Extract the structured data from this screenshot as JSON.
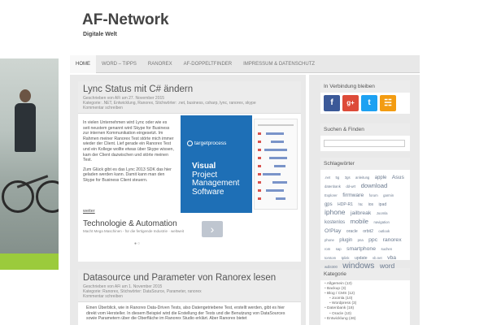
{
  "site": {
    "title": "AF-Network",
    "tagline": "Digitale Welt"
  },
  "nav": [
    {
      "label": "Home",
      "active": true
    },
    {
      "label": "Word – Tipps"
    },
    {
      "label": "Ranorex"
    },
    {
      "label": "AF-Doppeltfinder"
    },
    {
      "label": "Impressum & Datenschutz"
    }
  ],
  "posts": [
    {
      "title": "Lync Status mit C# ändern",
      "meta_line1": "Geschrieben von AFi am 27. November 2015",
      "meta_line2": "Kategorie: .NET, Entwicklung, Ranorex, Stichwörter: .net, business, csharp, lync, ranorex, skype",
      "meta_line3": "Kommentar schreiben",
      "para1": "In vielen Unternehmen wird Lync oder wie es seit neustem genannt wird Skype for Business zur internen Kommunikation eingesetzt. Im Rahmen meiner Ranorex Test störte mich immer wieder der Client. Lief gerade ein Ranorex Test und ein Kollege wollte etwas über Skype wissen, kam der Client dazwischen und störte meinen Test.",
      "para2": "Zum Glück gibt es das Lync 2013 SDK das hier geladen werden kann. Damit kann man den Skype for Business Client steuern.",
      "more": "weiter"
    },
    {
      "title": "Datasource und Parameter von Ranorex lesen",
      "meta_line1": "Geschrieben von AFi am 1. November 2015",
      "meta_line2": "Kategorie: Ranorex, Stichwörter: DataSource, Parameter, ranorex",
      "meta_line3": "Kommentar schreiben",
      "para1": "Einen Überblick, wie in Ranorex Data-Driven Tests, also Datengetriebene Test, erstellt werden, gibt es hier direkt vom Hersteller. In diesem Beispiel wird die Erstellung der Tests und die Benutzung von DataSources sowie Parametern über die Oberfläche im Ranorex Studio erklärt. Aber Ranorex bietet"
    }
  ],
  "ad_banner": {
    "brand": "targetprocess",
    "heading_line1": "Visual",
    "heading_line2": "Project",
    "heading_line3": "Management",
    "heading_line4": "Software",
    "color": "#1e6fb6"
  },
  "ad_text": {
    "title": "Technologie & Automation",
    "subtitle": "Macht Mega Maschinen - für die fertigende Industrie · weltweit",
    "button_icon": "chevron-right-icon"
  },
  "sidebar": {
    "social_title": "In Verbindung bleiben",
    "social": [
      {
        "icon": "f",
        "name": "facebook-icon",
        "color": "#3b5998"
      },
      {
        "icon": "g+",
        "name": "google-plus-icon",
        "color": "#dd4b39"
      },
      {
        "icon": "t",
        "name": "twitter-icon",
        "color": "#1da1f2"
      },
      {
        "icon": "rss",
        "name": "rss-icon",
        "color": "#f39c12"
      }
    ],
    "search_title": "Suchen & Finden",
    "search_placeholder": "",
    "tags_title": "Schlagwörter",
    "tags": [
      {
        "t": ".net",
        "s": 5
      },
      {
        "t": "5g",
        "s": 5
      },
      {
        "t": "3gs",
        "s": 5
      },
      {
        "t": "anleitung",
        "s": 5
      },
      {
        "t": "apple",
        "s": 7
      },
      {
        "t": "Asus",
        "s": 8
      },
      {
        "t": "datenbank",
        "s": 5
      },
      {
        "t": "dd-wrt",
        "s": 5
      },
      {
        "t": "download",
        "s": 9
      },
      {
        "t": "Explorer",
        "s": 5
      },
      {
        "t": "firmware",
        "s": 8
      },
      {
        "t": "forum",
        "s": 5
      },
      {
        "t": "garmin",
        "s": 5
      },
      {
        "t": "gps",
        "s": 7
      },
      {
        "t": "HDP-R1",
        "s": 6
      },
      {
        "t": "htc",
        "s": 5
      },
      {
        "t": "ios",
        "s": 6
      },
      {
        "t": "ipad",
        "s": 6
      },
      {
        "t": "iphone",
        "s": 10
      },
      {
        "t": "jailbreak",
        "s": 8
      },
      {
        "t": "Joomla",
        "s": 5
      },
      {
        "t": "kostenlos",
        "s": 7
      },
      {
        "t": "mobile",
        "s": 9
      },
      {
        "t": "navigation",
        "s": 5
      },
      {
        "t": "O!Play",
        "s": 8
      },
      {
        "t": "oracle",
        "s": 6
      },
      {
        "t": "orbit2",
        "s": 6
      },
      {
        "t": "outlook",
        "s": 5
      },
      {
        "t": "phone",
        "s": 5
      },
      {
        "t": "plugin",
        "s": 7
      },
      {
        "t": "pna",
        "s": 5
      },
      {
        "t": "ppc",
        "s": 8
      },
      {
        "t": "ranorex",
        "s": 8
      },
      {
        "t": "rom",
        "s": 5
      },
      {
        "t": "sap",
        "s": 5
      },
      {
        "t": "smartphone",
        "s": 8
      },
      {
        "t": "suchen",
        "s": 5
      },
      {
        "t": "tomtom",
        "s": 5
      },
      {
        "t": "tplink",
        "s": 5
      },
      {
        "t": "update",
        "s": 6
      },
      {
        "t": "vb.net",
        "s": 5
      },
      {
        "t": "vba",
        "s": 8
      },
      {
        "t": "wdl4300",
        "s": 5
      },
      {
        "t": "windows",
        "s": 12
      },
      {
        "t": "word",
        "s": 10
      }
    ],
    "cats_title": "Kategorie",
    "categories": [
      {
        "label": "Allgemein (13)",
        "sub": false
      },
      {
        "label": "Backup (3)",
        "sub": false
      },
      {
        "label": "Blog / CMS (12)",
        "sub": false
      },
      {
        "label": "Joomla (10)",
        "sub": true
      },
      {
        "label": "Wordpress (3)",
        "sub": true
      },
      {
        "label": "Datenbank (18)",
        "sub": false
      },
      {
        "label": "Oracle (10)",
        "sub": true
      },
      {
        "label": "Entwicklung (46)",
        "sub": false
      }
    ]
  }
}
